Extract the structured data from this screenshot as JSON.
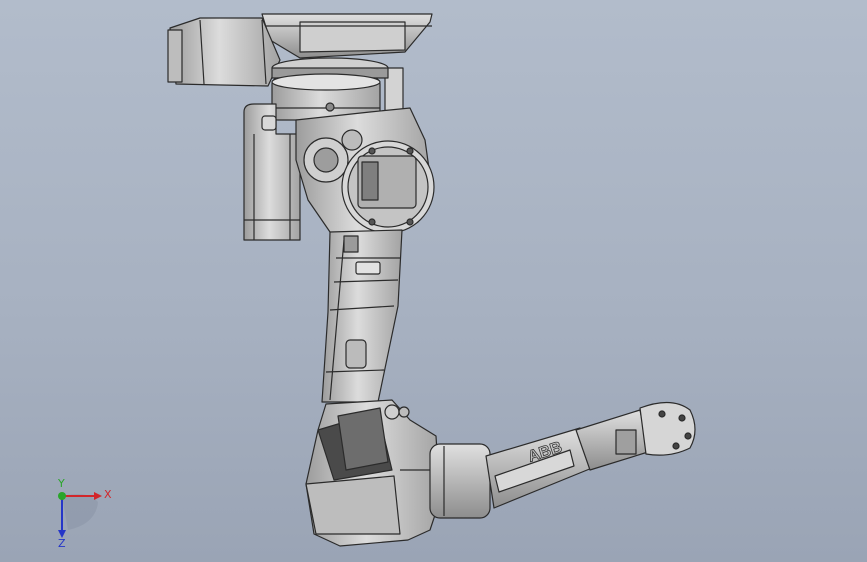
{
  "viewport": {
    "background_top": "#b2bccb",
    "background_bottom": "#9aa4b5"
  },
  "model": {
    "arm_label": "ABB",
    "colors": {
      "body": "#c8c8c8",
      "shade": "#8f8f8f",
      "edge": "#2b2b2b",
      "dark": "#4a4a4a"
    }
  },
  "triad": {
    "x_label": "X",
    "y_label": "Y",
    "z_label": "Z",
    "x_color": "#d2262a",
    "y_color": "#2aa52a",
    "z_color": "#2536c8",
    "icon": "coordinate-triad-icon"
  }
}
